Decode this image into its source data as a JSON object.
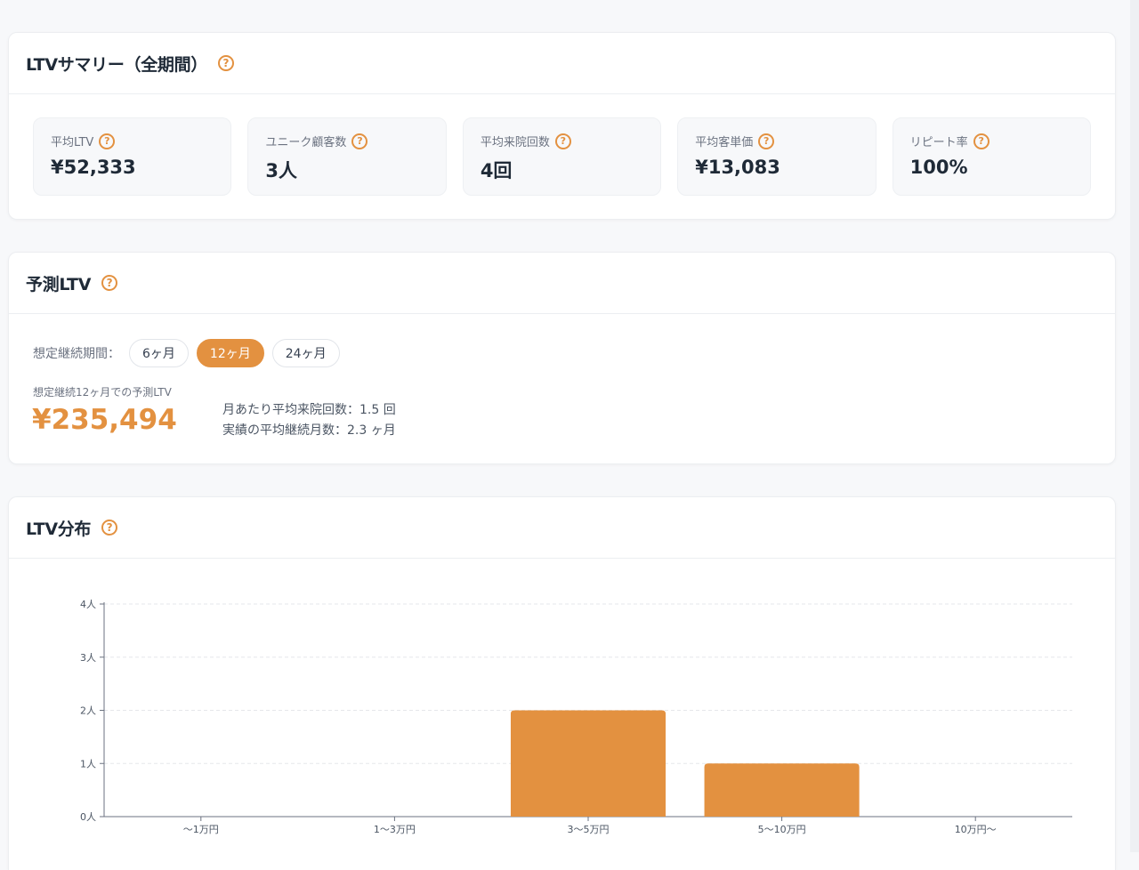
{
  "summary": {
    "title": "LTVサマリー（全期間）",
    "stats": [
      {
        "label": "平均LTV",
        "value": "¥52,333"
      },
      {
        "label": "ユニーク顧客数",
        "value": "3人"
      },
      {
        "label": "平均来院回数",
        "value": "4回"
      },
      {
        "label": "平均客単価",
        "value": "¥13,083"
      },
      {
        "label": "リピート率",
        "value": "100%"
      }
    ]
  },
  "prediction": {
    "title": "予測LTV",
    "period_label": "想定継続期間：",
    "periods": [
      "6ヶ月",
      "12ヶ月",
      "24ヶ月"
    ],
    "active_period": "12ヶ月",
    "caption": "想定継続12ヶ月での予測LTV",
    "value": "¥235,494",
    "note_visits": "月あたり平均来院回数：1.5 回",
    "note_months": "実績の平均継続月数：2.3 ヶ月"
  },
  "distribution": {
    "title": "LTV分布"
  },
  "chart_data": {
    "type": "bar",
    "categories": [
      "〜1万円",
      "1〜3万円",
      "3〜5万円",
      "5〜10万円",
      "10万円〜"
    ],
    "values": [
      0,
      0,
      2,
      1,
      0
    ],
    "y_ticks": [
      "0人",
      "1人",
      "2人",
      "3人",
      "4人"
    ],
    "ylim": [
      0,
      4
    ],
    "grid": true,
    "bar_color": "#e39140"
  },
  "colors": {
    "accent": "#e39140"
  },
  "icons": {
    "help": "question-circle-icon"
  }
}
